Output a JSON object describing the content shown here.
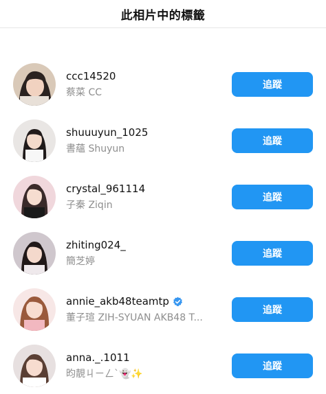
{
  "header": {
    "title": "此相片中的標籤"
  },
  "colors": {
    "accent": "#2196f3",
    "secondary_text": "#8e8e8e",
    "verified": "#3897f0"
  },
  "follow_label": "追蹤",
  "users": [
    {
      "username": "ccc14520",
      "fullname": "蔡菜 CC",
      "verified": false
    },
    {
      "username": "shuuuyun_1025",
      "fullname": "書蘊 Shuyun",
      "verified": false
    },
    {
      "username": "crystal_961114",
      "fullname": "子秦 Ziqin",
      "verified": false
    },
    {
      "username": "zhiting024_",
      "fullname": "簡芝婷",
      "verified": false
    },
    {
      "username": "annie_akb48teamtp",
      "fullname": "董子瑄 ZIH-SYUAN AKB48 T...",
      "verified": true
    },
    {
      "username": "anna._.1011",
      "fullname": "昀靚ㄐㄧㄥˋ👻✨",
      "verified": false
    }
  ]
}
